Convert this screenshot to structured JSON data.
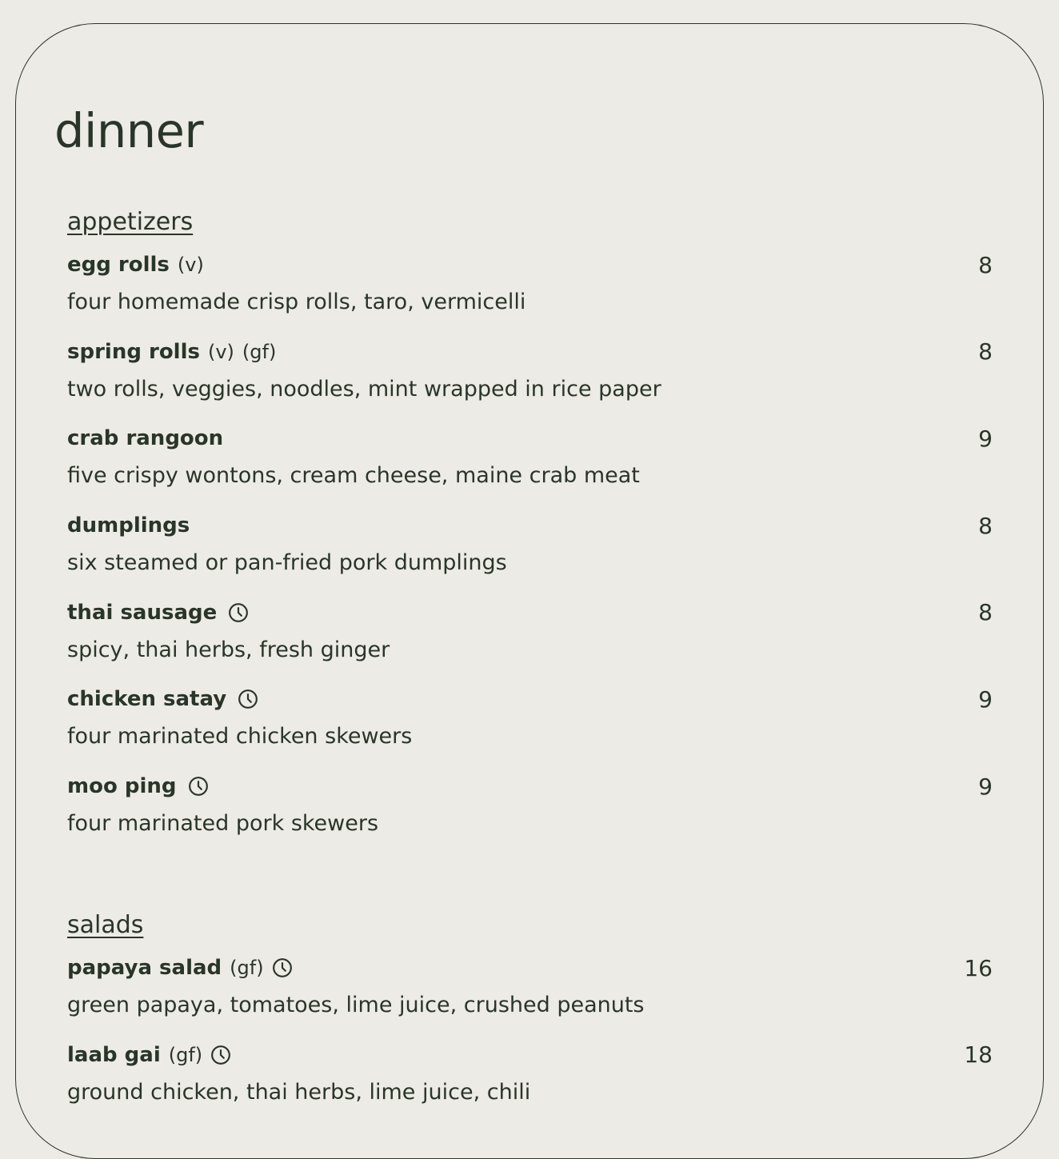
{
  "page": {
    "title": "dinner"
  },
  "sections": [
    {
      "heading": "appetizers",
      "items": [
        {
          "name": "egg rolls",
          "tags": [
            "(v)"
          ],
          "clock": false,
          "price": "8",
          "description": "four homemade crisp rolls, taro, vermicelli"
        },
        {
          "name": "spring rolls",
          "tags": [
            "(v)",
            "(gf)"
          ],
          "clock": false,
          "price": "8",
          "description": "two rolls, veggies, noodles, mint wrapped in rice paper"
        },
        {
          "name": "crab rangoon",
          "tags": [],
          "clock": false,
          "price": "9",
          "description": "five crispy wontons, cream cheese, maine crab meat"
        },
        {
          "name": "dumplings",
          "tags": [],
          "clock": false,
          "price": "8",
          "description": "six steamed or pan-fried pork dumplings"
        },
        {
          "name": "thai sausage",
          "tags": [],
          "clock": true,
          "price": "8",
          "description": "spicy, thai herbs, fresh ginger"
        },
        {
          "name": "chicken satay",
          "tags": [],
          "clock": true,
          "price": "9",
          "description": "four marinated chicken skewers"
        },
        {
          "name": "moo ping",
          "tags": [],
          "clock": true,
          "price": "9",
          "description": "four marinated pork skewers"
        }
      ]
    },
    {
      "heading": "salads",
      "items": [
        {
          "name": "papaya salad",
          "tags": [
            "(gf)"
          ],
          "clock": true,
          "price": "16",
          "description": "green papaya, tomatoes, lime juice, crushed peanuts"
        },
        {
          "name": "laab gai",
          "tags": [
            "(gf)"
          ],
          "clock": true,
          "price": "18",
          "description": "ground chicken, thai herbs, lime juice, chili"
        }
      ]
    }
  ],
  "icons": {
    "clock": "clock-icon"
  },
  "colors": {
    "background": "#edebe5",
    "text": "#2a3529"
  }
}
